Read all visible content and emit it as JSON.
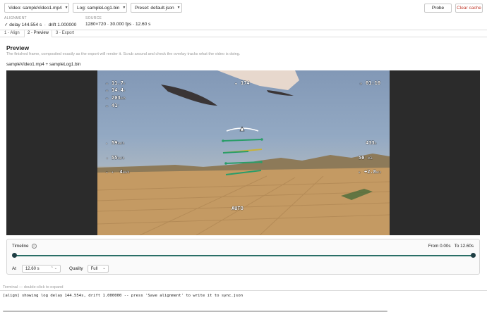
{
  "toolbar": {
    "video_label": "Video:",
    "video_value": "sampleVideo1.mp4",
    "log_label": "Log:",
    "log_value": "sampleLog1.bin",
    "preset_label": "Preset:",
    "preset_value": "default.json",
    "probe_label": "Probe",
    "clear_cache_label": "Clear cache"
  },
  "status": {
    "alignment_label": "ALIGNMENT",
    "alignment_check": "✓",
    "delay": "delay 144.554 s",
    "drift": "drift 1.000000",
    "source_label": "SOURCE",
    "source_value": "1280×720 · 30.000 fps · 12.60 s"
  },
  "tabs": [
    {
      "label": "1 - Align"
    },
    {
      "label": "2 - Preview",
      "active": true
    },
    {
      "label": "3 - Export"
    }
  ],
  "preview": {
    "title": "Preview",
    "description": "The finished frame, composited exactly as the export will render it. Scrub around and check the overlay tracks what the video is doing.",
    "files": "sampleVideo1.mp4 + sampleLog1.bin"
  },
  "osd": {
    "voltage": "11.7",
    "voltage_unit": "v",
    "cell": "14.4",
    "cell_unit": "v",
    "current": "203",
    "current_unit": "mAh",
    "temp": "41",
    "temp_unit": "°",
    "heading": "174",
    "flight_time": "01:10",
    "speed": "59",
    "speed_unit": "km/h",
    "airspeed": "55",
    "airspeed_unit": "km/h",
    "wind": "4",
    "wind_unit": "km/h",
    "home_dist": "433",
    "home_dist_unit": "m",
    "altitude": "50",
    "altitude_unit": "AGL",
    "vario": "+2.8",
    "vario_unit": "m/s",
    "mode": "AUTO"
  },
  "timeline": {
    "label": "Timeline",
    "info_icon": "info-icon",
    "from_label": "From 0.00s",
    "to_label": "To 12.60s",
    "position_fraction": 1.0,
    "at_label": "At",
    "at_value": "12.60 s",
    "quality_label": "Quality",
    "quality_value": "Full",
    "accent_color": "#2a6f67",
    "knob_color": "#1f3e44"
  },
  "terminal": {
    "label": "Terminal — double-click to expand",
    "line": "[align] showing log delay 144.554s, drift 1.000000 -- press 'Save alignment' to write it to sync.json"
  }
}
